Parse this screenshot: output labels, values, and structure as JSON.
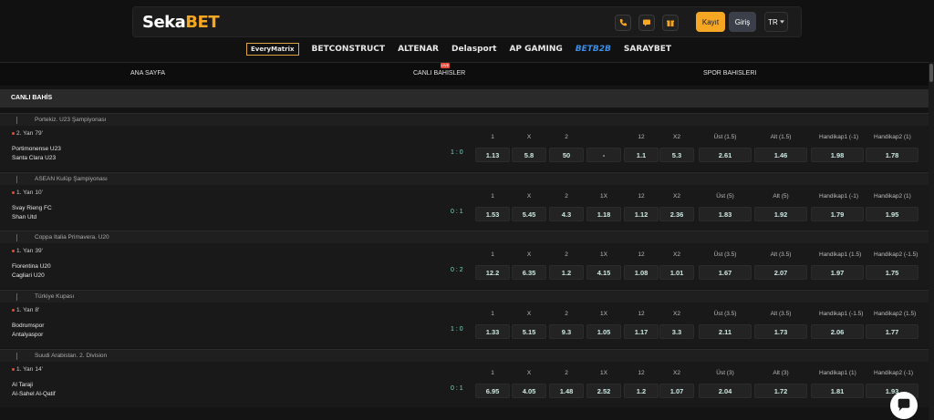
{
  "header": {
    "logo_main": "Seka",
    "logo_accent": "BET",
    "register_label": "Kayıt",
    "login_label": "Giriş",
    "language": "TR",
    "accent_color": "#f5a623"
  },
  "partners": [
    "EveryMatrix",
    "BETCONSTRUCT",
    "ALTENAR",
    "Delasport",
    "AP GAMING",
    "BETB2B",
    "SARAYBET"
  ],
  "nav": {
    "home": "ANA SAYFA",
    "live": "CANLI BAHISLER",
    "live_badge": "LIVE",
    "sports": "SPOR BAHISLERI"
  },
  "section_title": "CANLI BAHİS",
  "matches": [
    {
      "league": "Portekiz. U23 Şampiyonası",
      "status": "2. Yarı 79'",
      "home": "Portimonense U23",
      "away": "Santa Clara U23",
      "score": "1 : 0",
      "headers": [
        "1",
        "X",
        "2",
        "",
        "12",
        "X2",
        "Üst (1.5)",
        "Alt (1.5)",
        "Handikap1 (-1)",
        "Handikap2 (1)"
      ],
      "odds": [
        "1.13",
        "5.8",
        "50",
        "-",
        "1.1",
        "5.3",
        "2.61",
        "1.46",
        "1.98",
        "1.78"
      ]
    },
    {
      "league": "ASEAN Kulüp Şampiyonası",
      "status": "1. Yarı 10'",
      "home": "Svay Rieng FC",
      "away": "Shan Utd",
      "score": "0 : 1",
      "headers": [
        "1",
        "X",
        "2",
        "1X",
        "12",
        "X2",
        "Üst (5)",
        "Alt (5)",
        "Handikap1 (-1)",
        "Handikap2 (1)"
      ],
      "odds": [
        "1.53",
        "5.45",
        "4.3",
        "1.18",
        "1.12",
        "2.36",
        "1.83",
        "1.92",
        "1.79",
        "1.95"
      ]
    },
    {
      "league": "Coppa Italia Primavera. U20",
      "status": "1. Yarı 39'",
      "home": "Fiorentina U20",
      "away": "Cagliari U20",
      "score": "0 : 2",
      "headers": [
        "1",
        "X",
        "2",
        "1X",
        "12",
        "X2",
        "Üst (3.5)",
        "Alt (3.5)",
        "Handikap1 (1.5)",
        "Handikap2 (-1.5)"
      ],
      "odds": [
        "12.2",
        "6.35",
        "1.2",
        "4.15",
        "1.08",
        "1.01",
        "1.67",
        "2.07",
        "1.97",
        "1.75"
      ]
    },
    {
      "league": "Türkiye Kupası",
      "status": "1. Yarı 8'",
      "home": "Bodrumspor",
      "away": "Antalyaspor",
      "score": "1 : 0",
      "headers": [
        "1",
        "X",
        "2",
        "1X",
        "12",
        "X2",
        "Üst (3.5)",
        "Alt (3.5)",
        "Handikap1 (-1.5)",
        "Handikap2 (1.5)"
      ],
      "odds": [
        "1.33",
        "5.15",
        "9.3",
        "1.05",
        "1.17",
        "3.3",
        "2.11",
        "1.73",
        "2.06",
        "1.77"
      ]
    },
    {
      "league": "Suudi Arabistan. 2. Division",
      "status": "1. Yarı 14'",
      "home": "Al Taraji",
      "away": "Al-Sahel Al-Qatif",
      "score": "0 : 1",
      "headers": [
        "1",
        "X",
        "2",
        "1X",
        "12",
        "X2",
        "Üst (3)",
        "Alt (3)",
        "Handikap1 (1)",
        "Handikap2 (-1)"
      ],
      "odds": [
        "6.95",
        "4.05",
        "1.48",
        "2.52",
        "1.2",
        "1.07",
        "2.04",
        "1.72",
        "1.81",
        "1.93"
      ]
    }
  ]
}
